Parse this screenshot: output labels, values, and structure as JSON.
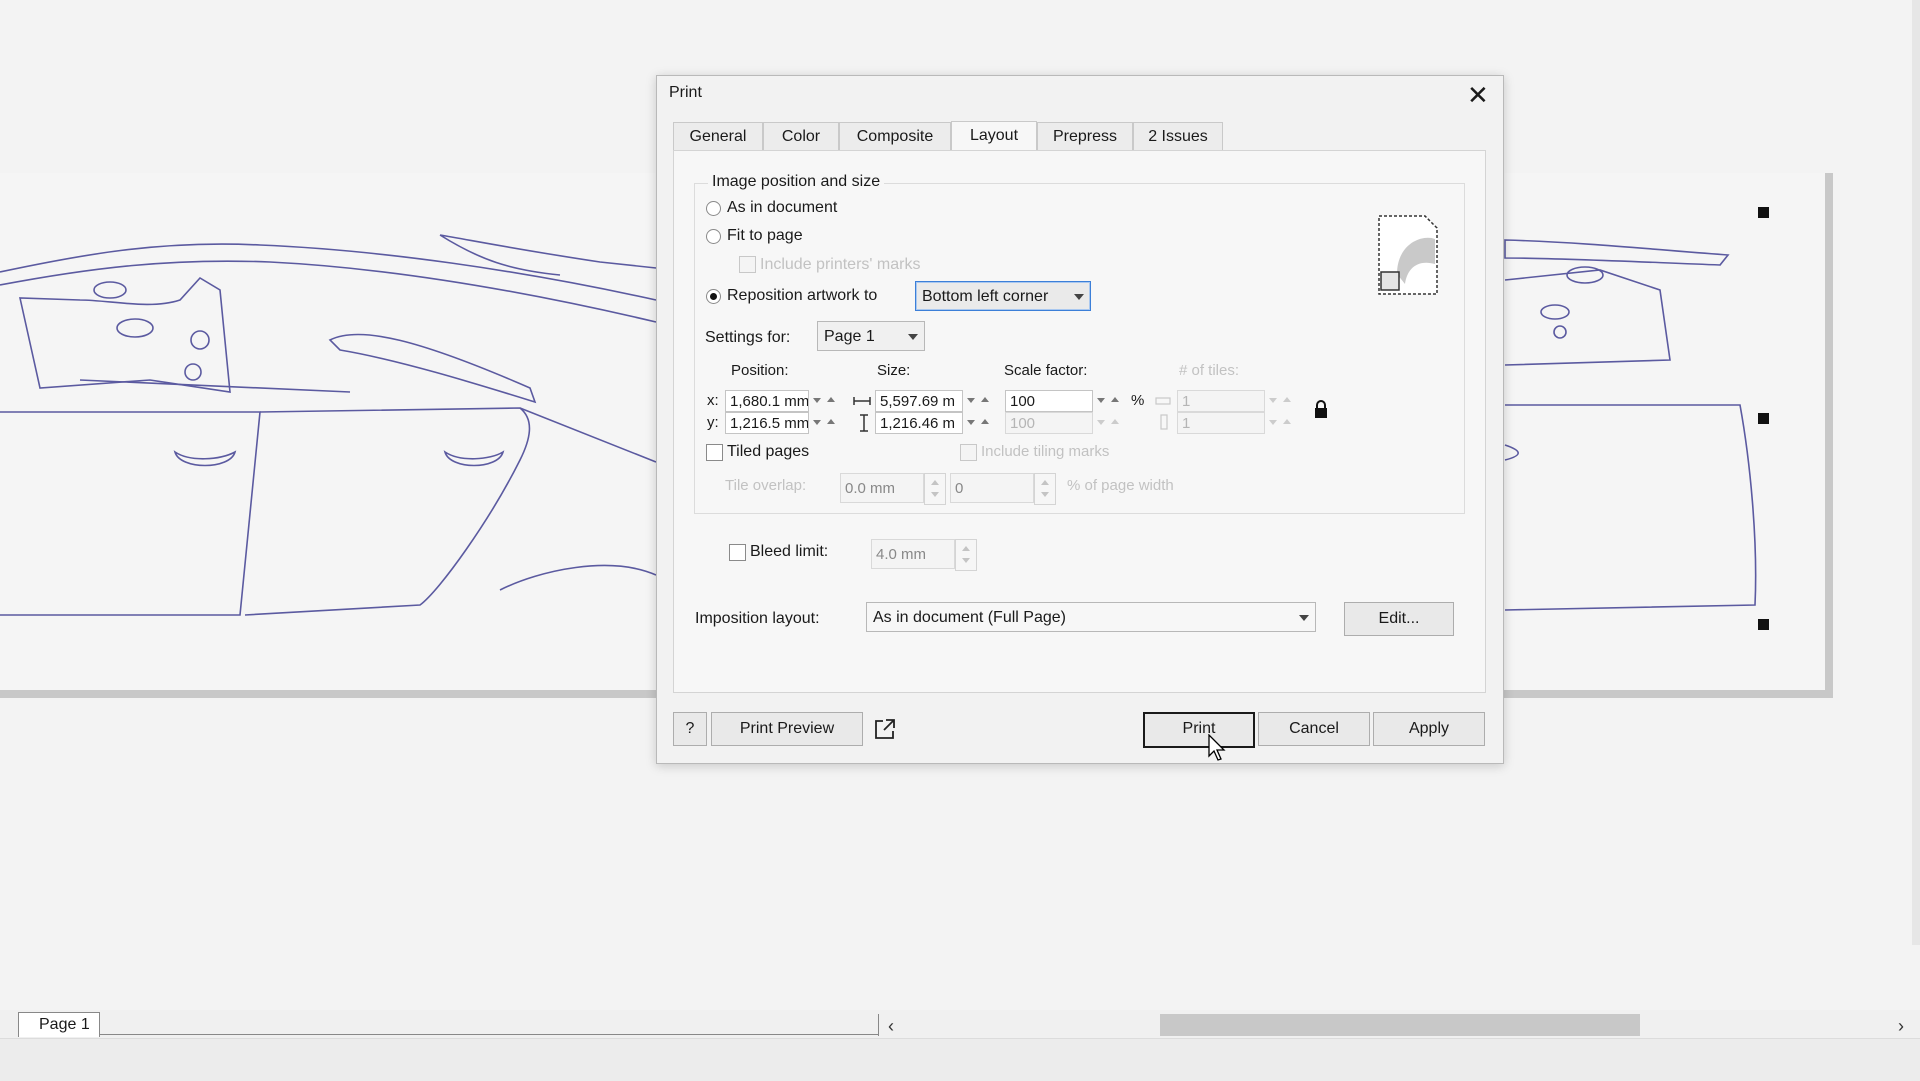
{
  "canvas": {
    "page_tab": "Page 1"
  },
  "dialog": {
    "title": "Print",
    "tabs": [
      "General",
      "Color",
      "Composite",
      "Layout",
      "Prepress",
      "2 Issues"
    ],
    "active_tab": "Layout",
    "group_title": "Image position and size",
    "options": {
      "as_in_document": "As in document",
      "fit_to_page": "Fit to page",
      "include_printers_marks": "Include printers' marks",
      "reposition_artwork": "Reposition artwork to",
      "selected": "reposition_artwork"
    },
    "reposition_select": "Bottom left corner",
    "settings_for_label": "Settings for:",
    "settings_for_value": "Page 1",
    "position_label": "Position:",
    "size_label": "Size:",
    "scale_label": "Scale factor:",
    "tiles_label": "# of tiles:",
    "x_label": "x:",
    "y_label": "y:",
    "x_value": "1,680.1 mm",
    "y_value": "1,216.5 mm",
    "width_value": "5,597.69 m",
    "height_value": "1,216.46 m",
    "scale_x": "100",
    "scale_y": "100",
    "percent": "%",
    "tiles_x": "1",
    "tiles_y": "1",
    "tiled_pages": "Tiled pages",
    "include_tiling_marks": "Include tiling marks",
    "tile_overlap_label": "Tile overlap:",
    "tile_overlap_value": "0.0 mm",
    "page_width_value": "0",
    "page_width_label": "% of page width",
    "bleed_limit_label": "Bleed limit:",
    "bleed_limit_value": "4.0 mm",
    "imposition_label": "Imposition layout:",
    "imposition_value": "As in document (Full Page)",
    "edit_button": "Edit...",
    "help_button": "?",
    "print_preview_button": "Print Preview",
    "print_button": "Print",
    "cancel_button": "Cancel",
    "apply_button": "Apply"
  },
  "colors": {
    "outline": "#5b5aa0",
    "focus": "#3c7fd8"
  },
  "icons": [
    "close-icon",
    "lock-icon",
    "link-icon",
    "external-window-icon",
    "page-preview-icon",
    "cursor-icon"
  ]
}
